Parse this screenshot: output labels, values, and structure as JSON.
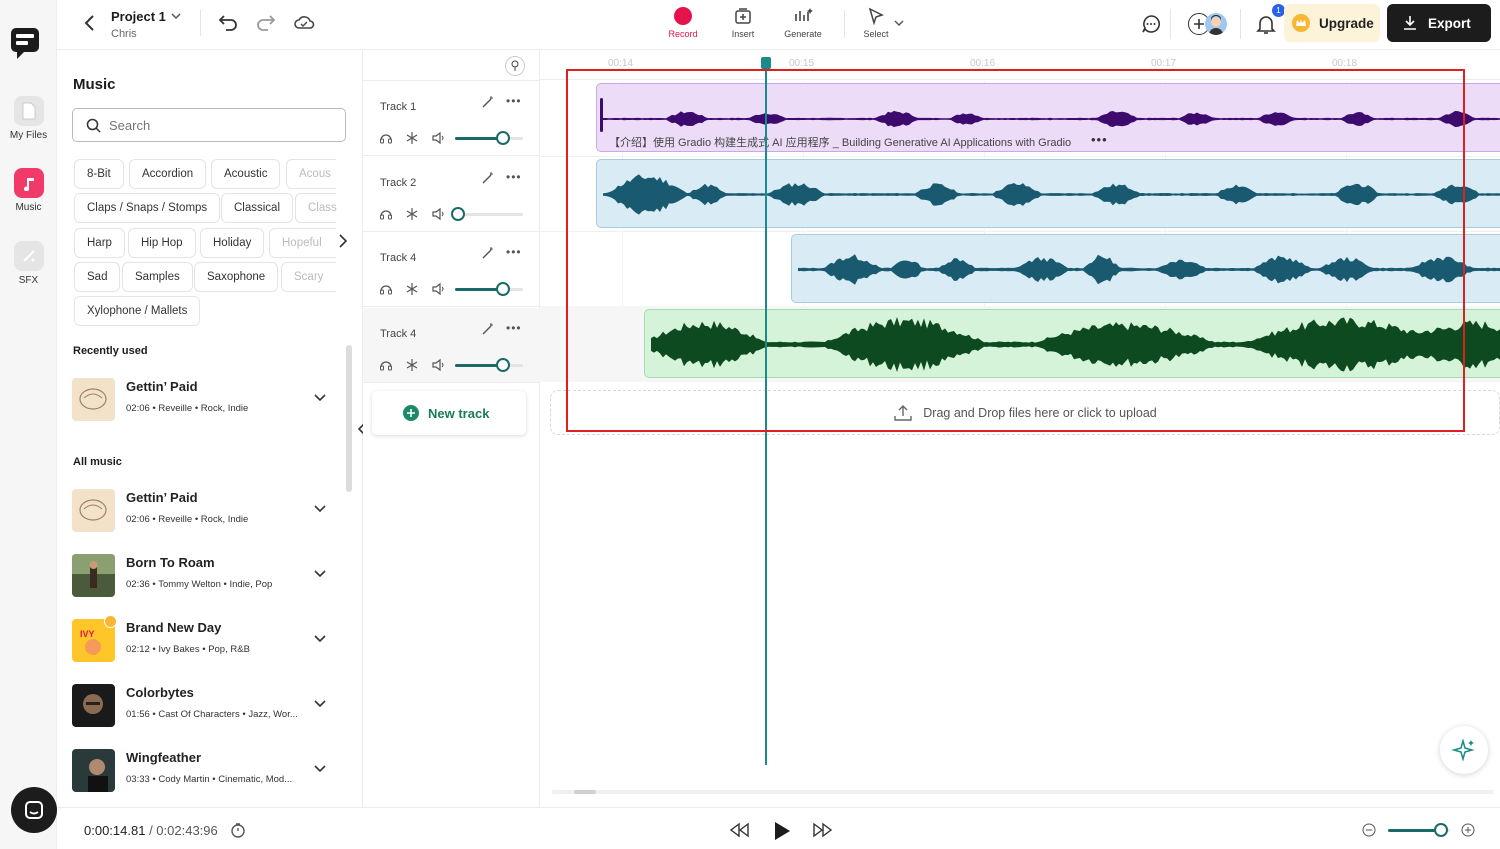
{
  "topbar": {
    "project_title": "Project 1",
    "project_owner": "Chris",
    "tools": {
      "record": "Record",
      "insert": "Insert",
      "generate": "Generate",
      "select": "Select"
    },
    "notification_count": "1",
    "upgrade_label": "Upgrade",
    "export_label": "Export"
  },
  "rail": {
    "items": [
      {
        "label": "My Files"
      },
      {
        "label": "Music"
      },
      {
        "label": "SFX"
      }
    ]
  },
  "panel": {
    "title": "Music",
    "search_placeholder": "Search",
    "genres": [
      "8-Bit",
      "Accordion",
      "Acoustic",
      "Acoustic",
      "Claps / Snaps / Stomps",
      "Classical",
      "Classical",
      "Harp",
      "Hip Hop",
      "Holiday",
      "Hopeful",
      "Sad",
      "Samples",
      "Saxophone",
      "Scary",
      "Xylophone / Mallets"
    ],
    "genre_visible": [
      "8-Bit",
      "Accordion",
      "Acoustic",
      "Acous",
      "Claps / Snaps / Stomps",
      "Classical",
      "Class",
      "Harp",
      "Hip Hop",
      "Holiday",
      "Hopeful",
      "Sad",
      "Samples",
      "Saxophone",
      "Scary",
      "Xylophone / Mallets"
    ],
    "recent_heading": "Recently used",
    "all_heading": "All music",
    "recent": [
      {
        "title": "Gettin’ Paid",
        "duration": "02:06",
        "artist": "Reveille",
        "genre": "Rock, Indie"
      }
    ],
    "all": [
      {
        "title": "Gettin’ Paid",
        "duration": "02:06",
        "artist": "Reveille",
        "genre": "Rock, Indie"
      },
      {
        "title": "Born To Roam",
        "duration": "02:36",
        "artist": "Tommy Welton",
        "genre": "Indie, Pop"
      },
      {
        "title": "Brand New Day",
        "duration": "02:12",
        "artist": "Ivy Bakes",
        "genre": "Pop, R&B"
      },
      {
        "title": "Colorbytes",
        "duration": "01:56",
        "artist": "Cast Of Characters",
        "genre": "Jazz, Wor..."
      },
      {
        "title": "Wingfeather",
        "duration": "03:33",
        "artist": "Cody Martin",
        "genre": "Cinematic, Mod..."
      }
    ]
  },
  "tracks": [
    {
      "name": "Track 1",
      "volume": 0.7
    },
    {
      "name": "Track 2",
      "volume": 0.05
    },
    {
      "name": "Track 4",
      "volume": 0.7
    },
    {
      "name": "Track 4",
      "volume": 0.7
    }
  ],
  "new_track_label": "New track",
  "timeline": {
    "ticks": [
      "00:14",
      "00:15",
      "00:16",
      "00:17",
      "00:18"
    ],
    "clip1_title": "【介绍】使用 Gradio 构建生成式 AI 应用程序 _ Building Generative AI Applications with Gradio",
    "dropzone_text": "Drag and Drop files here or click to upload",
    "colors": {
      "clip1": "#ecdcf7",
      "clip1_wave": "#3d0a6e",
      "clip2": "#d9ebf5",
      "clip2_wave": "#1a5a70",
      "clip4": "#d5f3d8",
      "clip4_wave": "#0d4a1f",
      "playhead": "#1a8a8a"
    }
  },
  "transport": {
    "current_time": "0:00:14.81",
    "total_time": "/ 0:02:43:96",
    "zoom_level": 0.85
  }
}
